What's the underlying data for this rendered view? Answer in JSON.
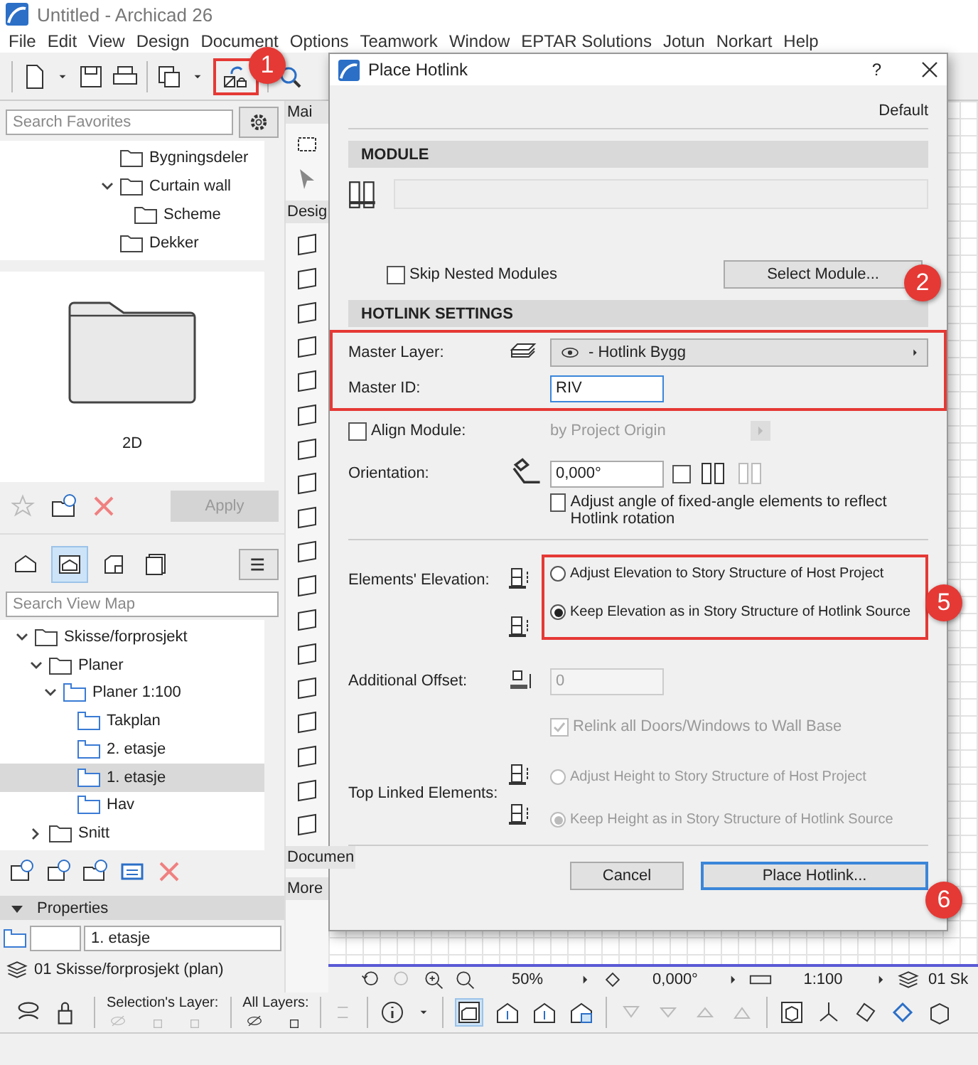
{
  "window": {
    "title": "Untitled - Archicad 26"
  },
  "menu": [
    "File",
    "Edit",
    "View",
    "Design",
    "Document",
    "Options",
    "Teamwork",
    "Window",
    "EPTAR Solutions",
    "Jotun",
    "Norkart",
    "Help"
  ],
  "favorites": {
    "search": {
      "placeholder": "Search Favorites"
    },
    "items": [
      {
        "label": "Bygningsdeler",
        "kind": "folder"
      },
      {
        "label": "Curtain wall",
        "kind": "folder",
        "expanded": true,
        "children": [
          {
            "label": "Scheme",
            "kind": "folder"
          }
        ]
      },
      {
        "label": "Dekker",
        "kind": "folder"
      }
    ]
  },
  "preview": {
    "caption": "2D"
  },
  "apply": {
    "label": "Apply",
    "disabled": true
  },
  "view_map": {
    "tabs": [
      {
        "kind": "project",
        "selected": false
      },
      {
        "kind": "views",
        "selected": true
      },
      {
        "kind": "layouts",
        "selected": false
      },
      {
        "kind": "publisher",
        "selected": false
      }
    ],
    "search": {
      "placeholder": "Search View Map"
    },
    "tree": [
      {
        "label": "Skisse/forprosjekt",
        "kind": "folder",
        "expanded": true,
        "selected": false,
        "children": [
          {
            "label": "Planer",
            "kind": "folder",
            "expanded": true,
            "selected": false,
            "children": [
              {
                "label": "Planer 1:100",
                "kind": "viewfolder",
                "expanded": true,
                "selected": false,
                "children": [
                  {
                    "label": "Takplan",
                    "kind": "view",
                    "selected": false
                  },
                  {
                    "label": "2. etasje",
                    "kind": "view",
                    "selected": false
                  },
                  {
                    "label": "1. etasje",
                    "kind": "view",
                    "selected": true
                  },
                  {
                    "label": "Hav",
                    "kind": "view",
                    "selected": false
                  }
                ]
              }
            ]
          },
          {
            "label": "Snitt",
            "kind": "folder",
            "expanded": false,
            "selected": false
          }
        ]
      }
    ]
  },
  "properties": {
    "title": "Properties",
    "expanded": true,
    "name": "1. etasje",
    "layer_combination": "01 Skisse/forprosjekt (plan)"
  },
  "toolbox": {
    "header": "Mai",
    "sections": [
      "Desig",
      "Documen",
      "More"
    ]
  },
  "navigator": {
    "zoom": "50%",
    "angle": "0,000°",
    "scale": "1:100",
    "layer": "01 Sk"
  },
  "layers_bar": {
    "selection_label": "Selection's Layer:",
    "all_label": "All Layers:"
  },
  "dialog": {
    "title": "Place Hotlink",
    "help": "?",
    "preset": "Default",
    "module": {
      "title": "MODULE",
      "skip_nested": {
        "label": "Skip Nested Modules",
        "checked": false
      },
      "select_button": "Select Module..."
    },
    "settings": {
      "title": "HOTLINK SETTINGS",
      "master_layer": {
        "label": "Master Layer:",
        "value": "- Hotlink Bygg"
      },
      "master_id": {
        "label": "Master ID:",
        "value": "RIV"
      },
      "align_module": {
        "label": "Align Module:",
        "checked": false,
        "value": "by Project Origin",
        "disabled": true
      },
      "orientation": {
        "label": "Orientation:",
        "value": "0,000°",
        "mirror_checked": false
      },
      "adjust_angle": {
        "label": "Adjust angle of fixed-angle elements to reflect Hotlink rotation",
        "checked": false
      }
    },
    "elevation": {
      "label": "Elements' Elevation:",
      "options": [
        {
          "label": "Adjust Elevation to Story Structure of Host Project",
          "selected": false
        },
        {
          "label": "Keep Elevation as in Story Structure of Hotlink Source",
          "selected": true
        }
      ]
    },
    "offset": {
      "label": "Additional Offset:",
      "value": "0",
      "disabled": true
    },
    "relink": {
      "label": "Relink all Doors/Windows to Wall Base",
      "checked": true,
      "disabled": true
    },
    "top_linked": {
      "label": "Top Linked Elements:",
      "disabled": true,
      "options": [
        {
          "label": "Adjust Height to Story Structure of Host Project",
          "selected": false
        },
        {
          "label": "Keep Height as in Story Structure of Hotlink Source",
          "selected": true
        }
      ]
    },
    "buttons": [
      {
        "label": "Cancel",
        "default": false
      },
      {
        "label": "Place Hotlink...",
        "default": true
      }
    ]
  },
  "callouts": [
    "1",
    "2",
    "5",
    "6"
  ]
}
